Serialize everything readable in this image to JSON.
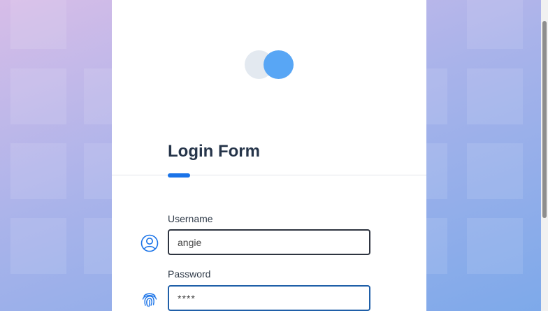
{
  "form": {
    "title": "Login Form",
    "username_label": "Username",
    "username_value": "angie",
    "password_label": "Password",
    "password_value": "****"
  },
  "icons": {
    "logo": "two-circles-logo",
    "username": "user-icon",
    "password": "fingerprint-icon"
  },
  "colors": {
    "accent": "#1a73e8",
    "logo_primary": "#58a6f5",
    "logo_secondary": "#e3e9f0",
    "title": "#26354a"
  }
}
